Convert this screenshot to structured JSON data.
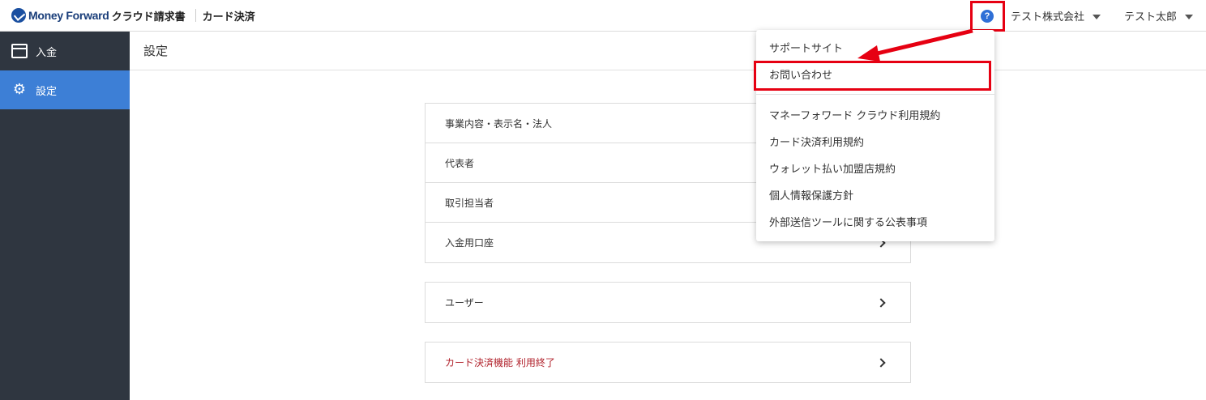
{
  "header": {
    "brand": "Money Forward",
    "product": "クラウド請求書",
    "service": "カード決済",
    "help_icon": "?",
    "company": "テスト株式会社",
    "user": "テスト太郎"
  },
  "sidebar": {
    "items": [
      {
        "label": "入金",
        "icon": "calendar-icon"
      },
      {
        "label": "設定",
        "icon": "gear-icon"
      }
    ]
  },
  "main": {
    "title": "設定",
    "cards": [
      {
        "rows": [
          "事業内容・表示名・法人",
          "代表者",
          "取引担当者",
          "入金用口座"
        ]
      },
      {
        "rows": [
          "ユーザー"
        ]
      },
      {
        "rows": [
          "カード決済機能 利用終了"
        ]
      }
    ]
  },
  "help_menu": {
    "items": [
      "サポートサイト",
      "お問い合わせ",
      "マネーフォワード クラウド利用規約",
      "カード決済利用規約",
      "ウォレット払い加盟店規約",
      "個人情報保護方針",
      "外部送信ツールに関する公表事項"
    ]
  },
  "colors": {
    "sidebar_bg": "#2f3640",
    "active": "#3d7fd6",
    "annotation": "#e60012",
    "danger_text": "#b0202a"
  }
}
